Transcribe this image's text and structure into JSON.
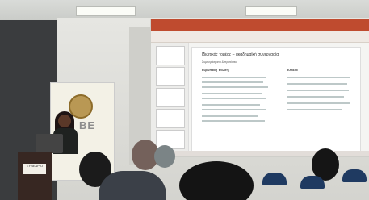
{
  "scene": {
    "banner_text": "BE"
  },
  "slide": {
    "title": "Ιδιωτικός τομέας – ακαδημαϊκή συνεργασία",
    "subtitle": "Συμπεράσματα & προτάσεις",
    "left_heading": "Ευρωπαϊκή Ένωση",
    "right_heading": "Ελλάδα"
  },
  "podium": {
    "sign": "ΣΥΝΕΔΡΙΟ"
  }
}
